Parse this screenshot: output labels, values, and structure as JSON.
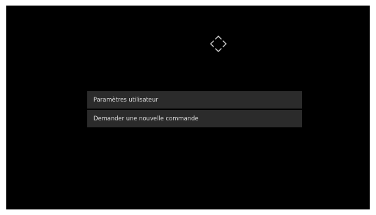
{
  "icons": {
    "dpad": "dpad-navigation-icon"
  },
  "colors": {
    "screen_background": "#000000",
    "menu_item_background": "#2b2b2b",
    "menu_item_text": "#dcdcdc"
  },
  "menu": {
    "items": [
      {
        "label": "Paramètres utilisateur"
      },
      {
        "label": "Demander une nouvelle commande"
      }
    ]
  }
}
